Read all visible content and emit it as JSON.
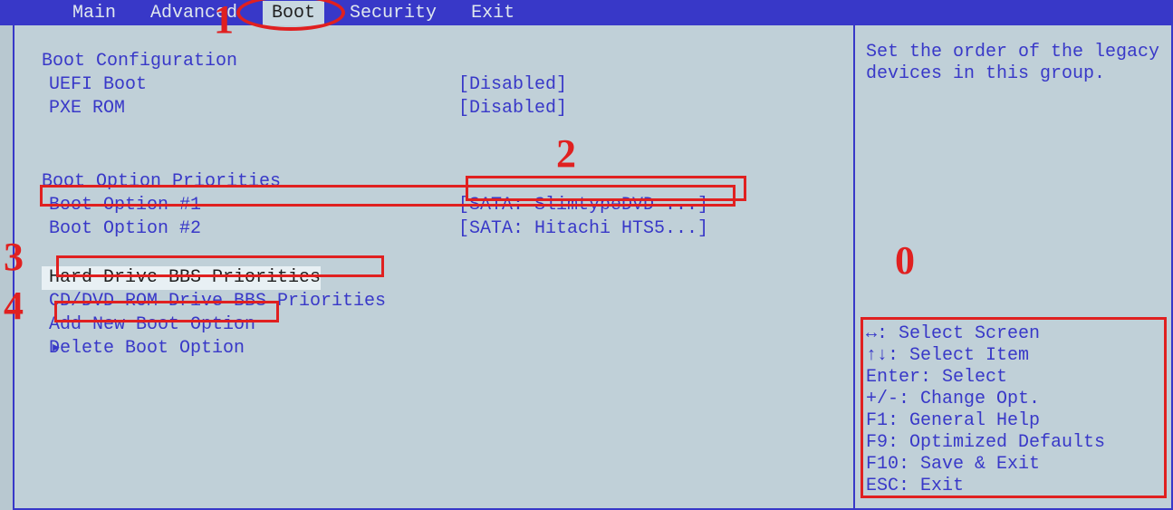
{
  "menubar": {
    "tabs": [
      "Main",
      "Advanced",
      "Boot",
      "Security",
      "Exit"
    ],
    "active_index": 2
  },
  "boot_config": {
    "header": "Boot Configuration",
    "uefi_label": "UEFI Boot",
    "uefi_value": "[Disabled]",
    "pxe_label": "PXE ROM",
    "pxe_value": "[Disabled]"
  },
  "priorities": {
    "header": "Boot Option Priorities",
    "opt1_label": "Boot Option #1",
    "opt1_value": "[SATA: SlimtypeDVD ...]",
    "opt2_label": "Boot Option #2",
    "opt2_value": "[SATA: Hitachi HTS5...]"
  },
  "submenus": {
    "hdd_bbs": "Hard Drive BBS Priorities",
    "cd_bbs": "CD/DVD ROM Drive BBS Priorities",
    "add_opt": "Add New Boot Option",
    "del_opt": "Delete Boot Option"
  },
  "help": {
    "description": "Set the order of the legacy devices in this group.",
    "keys": [
      "↔: Select Screen",
      "↑↓: Select Item",
      "Enter: Select",
      "+/-: Change Opt.",
      "F1: General Help",
      "F9: Optimized Defaults",
      "F10: Save & Exit",
      "ESC: Exit"
    ]
  },
  "annotations": {
    "n1": "1",
    "n2": "2",
    "n3": "3",
    "n4": "4",
    "n0": "0"
  }
}
